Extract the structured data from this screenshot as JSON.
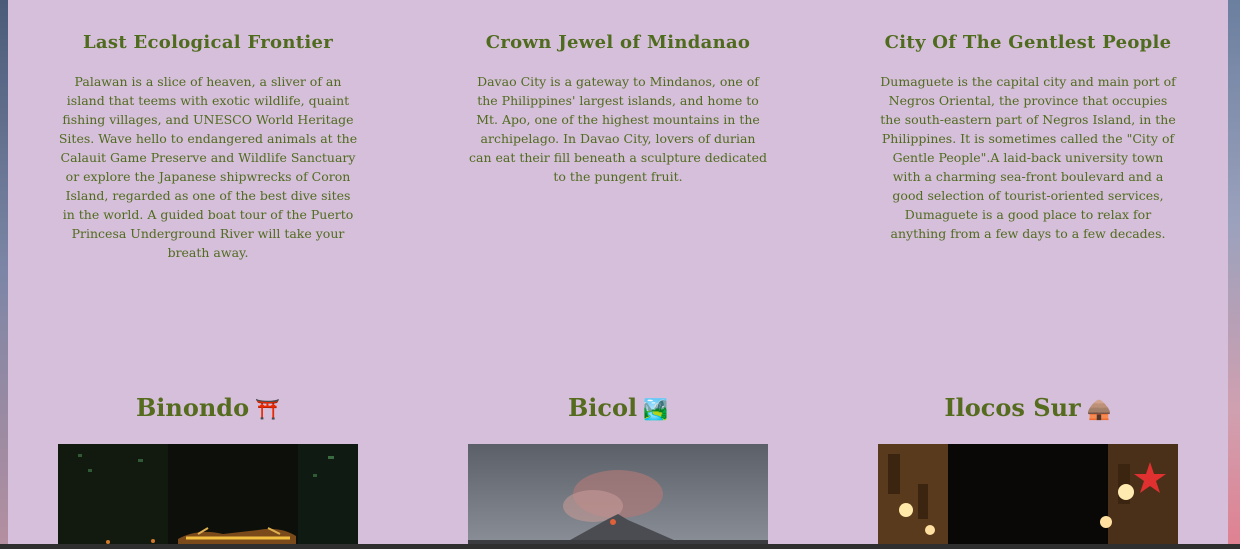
{
  "features": [
    {
      "title": "Last Ecological Frontier",
      "text": "Palawan is a slice of heaven, a sliver of an island that teems with exotic wildlife, quaint fishing villages, and UNESCO World Heritage Sites. Wave hello to endangered animals at the Calauit Game Preserve and Wildlife Sanctuary or explore the Japanese shipwrecks of Coron Island, regarded as one of the best dive sites in the world. A guided boat tour of the Puerto Princesa Underground River will take your breath away."
    },
    {
      "title": "Crown Jewel of Mindanao",
      "text": "Davao City is a gateway to Mindanos, one of the Philippines' largest islands, and home to Mt. Apo, one of the highest mountains in the archipelago. In Davao City, lovers of durian can eat their fill beneath a sculpture dedicated to the pungent fruit."
    },
    {
      "title": "City Of The Gentlest People",
      "text": "Dumaguete is the capital city and main port of Negros Oriental, the province that occupies the south-eastern part of Negros Island, in the Philippines. It is sometimes called the \"City of Gentle People\".A laid-back university town with a charming sea-front boulevard and a good selection of tourist-oriented services, Dumaguete is a good place to relax for anything from a few days to a few decades."
    }
  ],
  "destinations": [
    {
      "name": "Binondo",
      "emoji": "⛩️",
      "icon": "torii-gate-icon"
    },
    {
      "name": "Bicol",
      "emoji": "🏞️",
      "icon": "national-park-icon"
    },
    {
      "name": "Ilocos Sur",
      "emoji": "🛖",
      "icon": "hut-icon"
    }
  ]
}
